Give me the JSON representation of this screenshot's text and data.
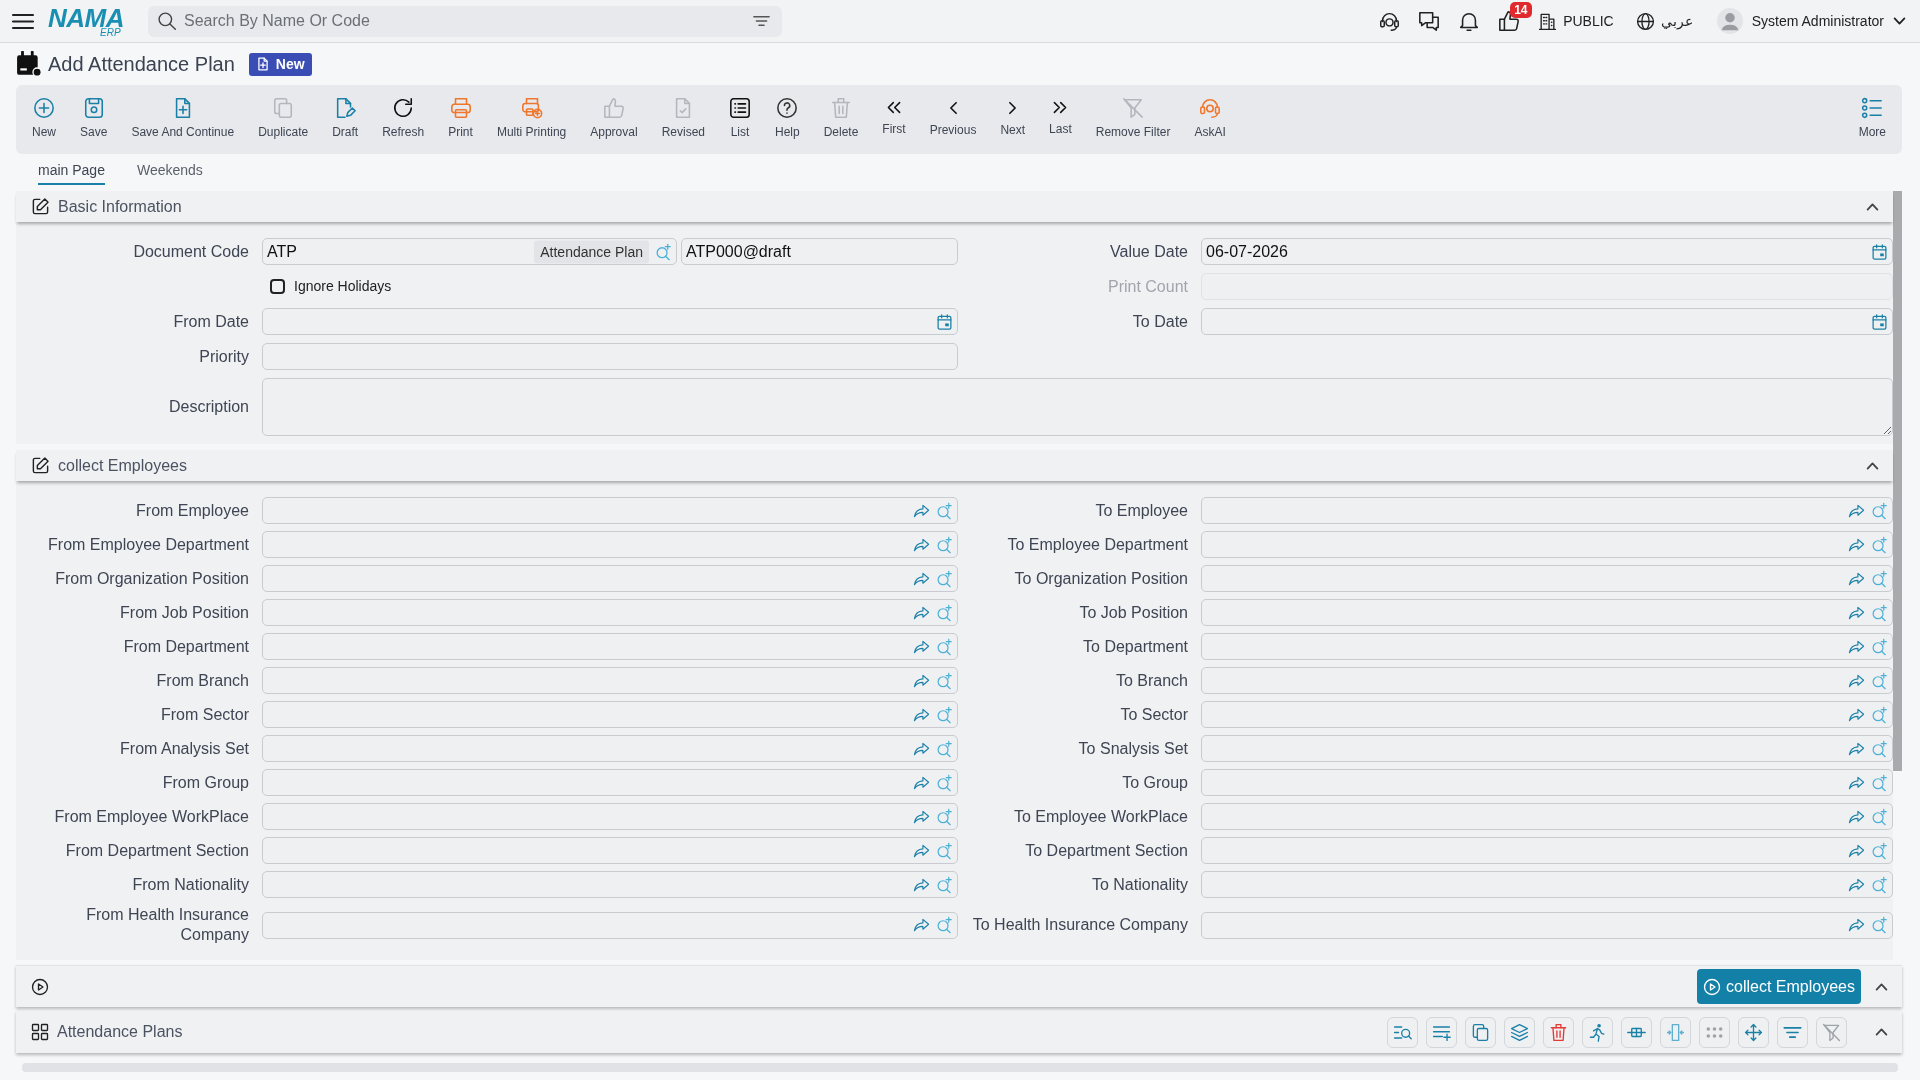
{
  "topbar": {
    "logo": "NAMA",
    "logo_tag": "ERP",
    "search": {
      "placeholder": "Search By Name Or Code"
    },
    "likes_count": "14",
    "company": "PUBLIC",
    "language": "عربي",
    "user": "System Administrator"
  },
  "page": {
    "title": "Add Attendance Plan",
    "status": "New"
  },
  "toolbar": {
    "buttons": [
      {
        "label": "New",
        "disabled": false
      },
      {
        "label": "Save",
        "disabled": false
      },
      {
        "label": "Save And Continue",
        "disabled": false
      },
      {
        "label": "Duplicate",
        "disabled": true
      },
      {
        "label": "Draft",
        "disabled": false
      },
      {
        "label": "Refresh",
        "disabled": false
      },
      {
        "label": "Print",
        "disabled": false
      },
      {
        "label": "Multi Printing",
        "disabled": false
      },
      {
        "label": "Approval",
        "disabled": true
      },
      {
        "label": "Revised",
        "disabled": true
      },
      {
        "label": "List",
        "disabled": false
      },
      {
        "label": "Help",
        "disabled": false
      },
      {
        "label": "Delete",
        "disabled": true
      },
      {
        "label": "First",
        "disabled": false
      },
      {
        "label": "Previous",
        "disabled": false
      },
      {
        "label": "Next",
        "disabled": false
      },
      {
        "label": "Last",
        "disabled": false
      },
      {
        "label": "Remove Filter",
        "disabled": true
      },
      {
        "label": "AskAI",
        "disabled": false
      }
    ],
    "more": "More"
  },
  "tabs": [
    {
      "label": "main Page",
      "selected": true
    },
    {
      "label": "Weekends",
      "selected": false
    }
  ],
  "basic_information": {
    "title": "Basic Information",
    "expanded": true,
    "document_code": {
      "label": "Document Code",
      "value": "ATP",
      "type": "Attendance Plan",
      "number": "ATP000@draft"
    },
    "value_date": {
      "label": "Value Date",
      "value": "06-07-2026"
    },
    "ignore_holidays": {
      "label": "Ignore Holidays",
      "checked": false
    },
    "print_count": {
      "label": "Print Count",
      "disabled": true
    },
    "from_date": {
      "label": "From Date"
    },
    "to_date": {
      "label": "To Date"
    },
    "priority": {
      "label": "Priority"
    },
    "description": {
      "label": "Description"
    }
  },
  "collect_employees": {
    "title": "collect Employees",
    "expanded": true,
    "rows": [
      {
        "from": "From Employee",
        "to": "To Employee"
      },
      {
        "from": "From Employee Department",
        "to": "To Employee Department"
      },
      {
        "from": "From Organization Position",
        "to": "To Organization Position"
      },
      {
        "from": "From Job Position",
        "to": "To Job Position"
      },
      {
        "from": "From Department",
        "to": "To Department"
      },
      {
        "from": "From Branch",
        "to": "To Branch"
      },
      {
        "from": "From Sector",
        "to": "To Sector"
      },
      {
        "from": "From Analysis Set",
        "to": "To Snalysis Set"
      },
      {
        "from": "From Group",
        "to": "To Group"
      },
      {
        "from": "From Employee WorkPlace",
        "to": "To Employee WorkPlace"
      },
      {
        "from": "From Department Section",
        "to": "To Department Section"
      },
      {
        "from": "From Nationality",
        "to": "To Nationality"
      },
      {
        "from": "From Health Insurance Company",
        "to": "To Health Insurance Company"
      }
    ],
    "action": "collect Employees"
  },
  "attendance_plans": {
    "title": "Attendance Plans",
    "expanded": true,
    "tools": [
      {
        "disabled": false
      },
      {
        "disabled": false
      },
      {
        "disabled": false
      },
      {
        "disabled": false
      },
      {
        "disabled": false
      },
      {
        "disabled": false
      },
      {
        "disabled": false
      },
      {
        "disabled": false
      },
      {
        "disabled": true
      },
      {
        "disabled": false
      },
      {
        "disabled": false
      },
      {
        "disabled": true
      }
    ]
  }
}
